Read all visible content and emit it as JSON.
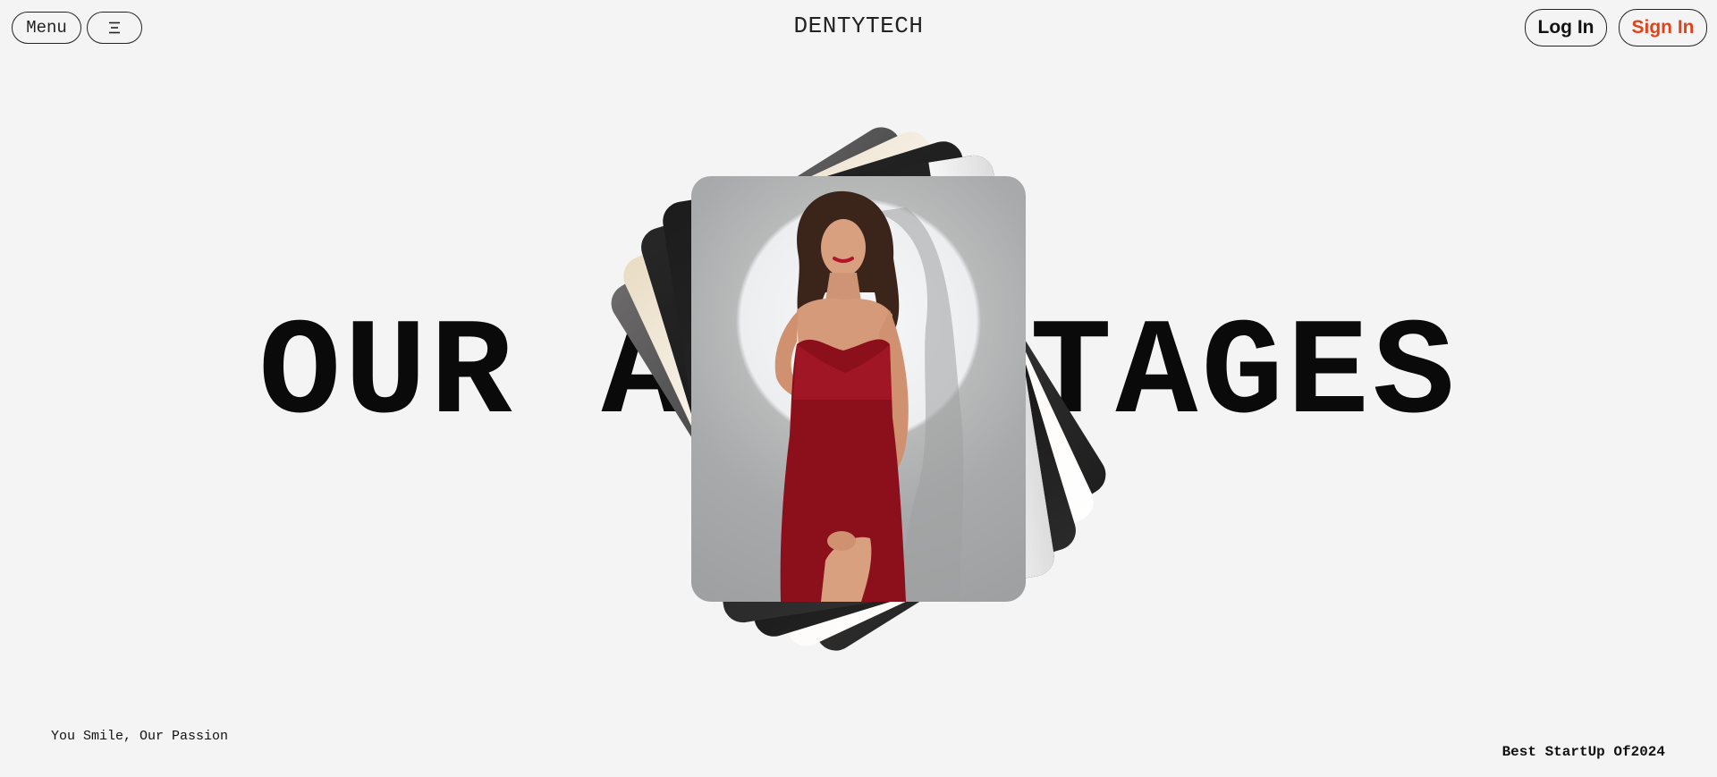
{
  "header": {
    "menu_label": "Menu",
    "menu_icon": "hamburger-icon",
    "logo": "DENTYTECH",
    "login_label": "Log In",
    "signin_label": "Sign In"
  },
  "hero": {
    "headline": "OUR ADVANTAGES",
    "image_subject": "woman in red satin dress"
  },
  "footer": {
    "tagline": "You Smile, Our Passion",
    "award": "Best StartUp Of2024"
  },
  "colors": {
    "background": "#f4f4f4",
    "text": "#111111",
    "accent": "#e0421c"
  }
}
